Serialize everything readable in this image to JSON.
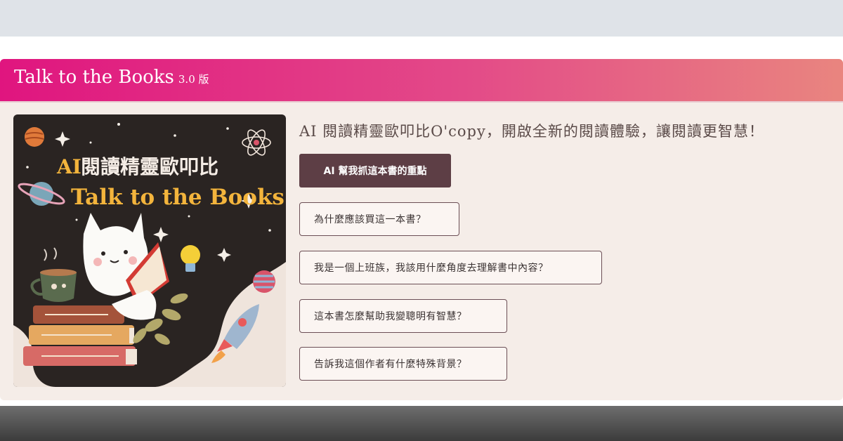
{
  "header": {
    "title": "Talk to the Books",
    "version": "3.0 版"
  },
  "cover": {
    "title_line1_prefix": "AI",
    "title_line1_rest": "閱讀精靈歐叩比",
    "title_line2": "Talk to the Books"
  },
  "main": {
    "headline": "AI 閱讀精靈歐叩比O'copy，開啟全新的閱讀體驗，讓閱讀更智慧！",
    "primary_button": "AI 幫我抓這本書的重點",
    "questions": [
      "為什麼應該買這一本書？",
      "我是一個上班族，我該用什麼角度去理解書中內容？",
      "這本書怎麼幫助我變聰明有智慧？",
      "告訴我這個作者有什麼特殊背景？"
    ]
  },
  "colors": {
    "header_gradient_start": "#e0157f",
    "header_gradient_end": "#e9857f",
    "card_background": "#f5ede8",
    "primary_button": "#5d3e45",
    "cover_dark": "#2a2422",
    "cover_title_gold": "#f3b43c"
  }
}
